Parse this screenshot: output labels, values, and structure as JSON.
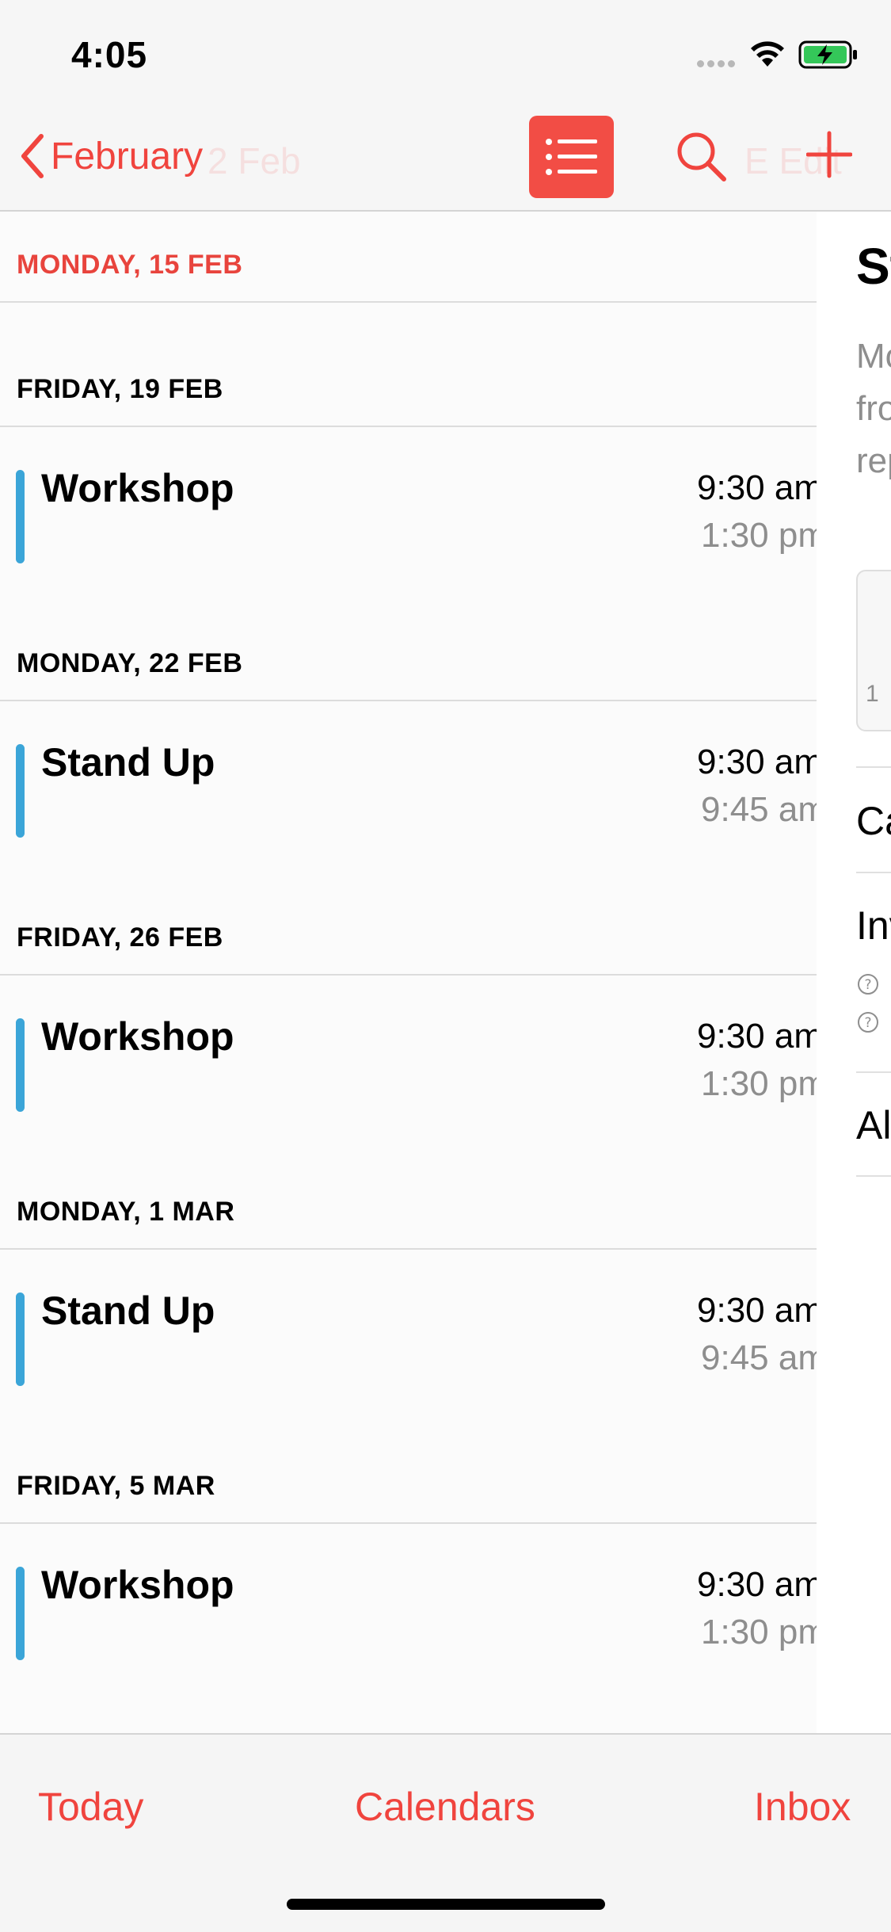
{
  "status": {
    "time": "4:05"
  },
  "nav": {
    "back_label": "February",
    "ghost_date": "2 Feb",
    "ghost_edit": "E Edit"
  },
  "sections": [
    {
      "header": "MONDAY, 15 FEB",
      "today": true,
      "events": []
    },
    {
      "header": "FRIDAY, 19 FEB",
      "events": [
        {
          "title": "Workshop",
          "start": "9:30 am",
          "end": "1:30 pm"
        }
      ]
    },
    {
      "header": "MONDAY, 22 FEB",
      "events": [
        {
          "title": "Stand Up",
          "start": "9:30 am",
          "end": "9:45 am"
        }
      ]
    },
    {
      "header": "FRIDAY, 26 FEB",
      "events": [
        {
          "title": "Workshop",
          "start": "9:30 am",
          "end": "1:30 pm"
        }
      ]
    },
    {
      "header": "MONDAY, 1 MAR",
      "events": [
        {
          "title": "Stand Up",
          "start": "9:30 am",
          "end": "9:45 am"
        }
      ]
    },
    {
      "header": "FRIDAY, 5 MAR",
      "events": [
        {
          "title": "Workshop",
          "start": "9:30 am",
          "end": "1:30 pm"
        }
      ]
    }
  ],
  "detail": {
    "title": "St",
    "notes_lines": [
      "Mo",
      "fro",
      "rep"
    ],
    "card_number": "1",
    "rows": [
      "Ca",
      "Inv",
      "Al"
    ]
  },
  "tabs": {
    "today": "Today",
    "calendars": "Calendars",
    "inbox": "Inbox"
  },
  "colors": {
    "accent": "#f0443e",
    "event_bar": "#3ba5d8",
    "secondary_text": "#8e8e8e"
  }
}
